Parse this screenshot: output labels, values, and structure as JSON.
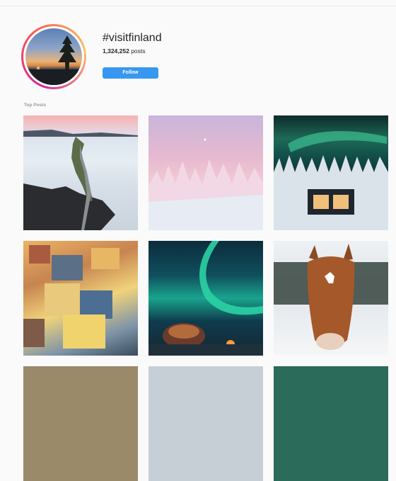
{
  "header": {
    "hashtag": "#visitfinland",
    "post_count": "1,324,252",
    "post_count_suffix": "posts",
    "follow_label": "Follow"
  },
  "sections": {
    "top_posts_label": "Top Posts"
  },
  "colors": {
    "accent": "#3897f0",
    "background": "#fafafa",
    "text": "#262626"
  },
  "posts": [
    {
      "subject": "aerial-lake-road"
    },
    {
      "subject": "snowy-trees-pink-sky"
    },
    {
      "subject": "aurora-glass-cabin"
    },
    {
      "subject": "aerial-town-buildings"
    },
    {
      "subject": "aurora-glass-igloo"
    },
    {
      "subject": "horse-in-snow"
    },
    {
      "subject": "partial-post"
    },
    {
      "subject": "partial-post"
    },
    {
      "subject": "partial-post"
    }
  ]
}
